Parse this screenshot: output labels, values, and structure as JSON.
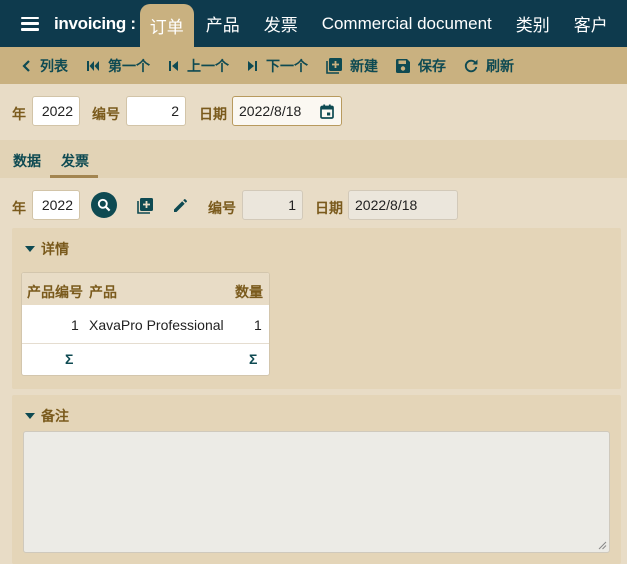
{
  "app": {
    "name": "invoicing :"
  },
  "nav": {
    "tabs": [
      "订单",
      "产品",
      "发票",
      "Commercial document",
      "类别",
      "客户"
    ]
  },
  "toolbar": {
    "list": "列表",
    "first": "第一个",
    "prev": "上一个",
    "next": "下一个",
    "new": "新建",
    "save": "保存",
    "refresh": "刷新"
  },
  "header_form": {
    "year_label": "年",
    "year_value": "2022",
    "number_label": "编号",
    "number_value": "2",
    "date_label": "日期",
    "date_value": "2022/8/18"
  },
  "tabs": {
    "data": "数据",
    "invoice": "发票"
  },
  "invoice_form": {
    "year_label": "年",
    "year_value": "2022",
    "number_label": "编号",
    "number_value": "1",
    "date_label": "日期",
    "date_value": "2022/8/18"
  },
  "details": {
    "title": "详情",
    "columns": [
      "产品编号",
      "产品",
      "数量"
    ],
    "rows": [
      {
        "product_number": "1",
        "product": "XavaPro Professional",
        "quantity": "1"
      }
    ],
    "sum_symbol": "Σ"
  },
  "notes": {
    "title": "备注",
    "value": ""
  },
  "colors": {
    "topbar": "#0e3a4d",
    "toolbar": "#c9b180",
    "accent": "#0e4a52",
    "label": "#7a5a1c"
  }
}
